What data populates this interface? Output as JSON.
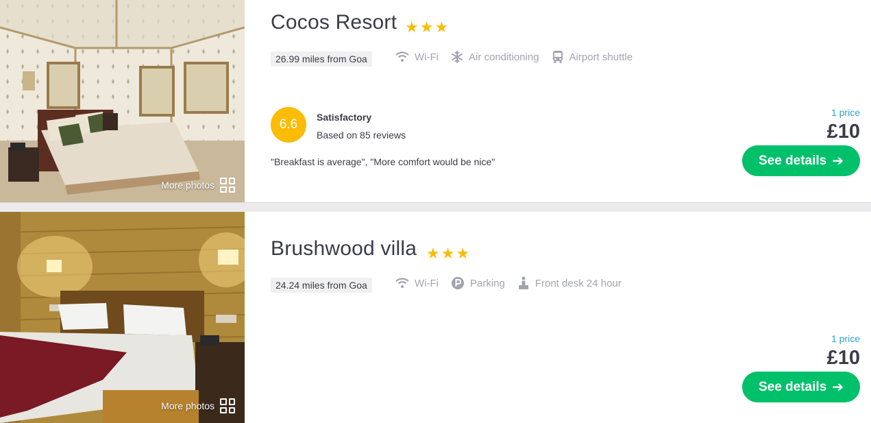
{
  "hotels": [
    {
      "name": "Cocos Resort",
      "star_rating": 3,
      "distance": "26.99 miles from Goa",
      "amenities": [
        {
          "icon": "wifi-icon",
          "label": "Wi-Fi"
        },
        {
          "icon": "snowflake-icon",
          "label": "Air conditioning"
        },
        {
          "icon": "bus-icon",
          "label": "Airport shuttle"
        }
      ],
      "score": "6.6",
      "rating_word": "Satisfactory",
      "review_count": "Based on 85 reviews",
      "quote": "\"Breakfast is average\", \"More comfort would be nice\"",
      "price_count": "1 price",
      "price": "£10",
      "cta": "See details",
      "more_photos": "More photos"
    },
    {
      "name": "Brushwood villa",
      "star_rating": 3,
      "distance": "24.24 miles from Goa",
      "amenities": [
        {
          "icon": "wifi-icon",
          "label": "Wi-Fi"
        },
        {
          "icon": "parking-icon",
          "label": "Parking"
        },
        {
          "icon": "front-desk-icon",
          "label": "Front desk 24 hour"
        }
      ],
      "price_count": "1 price",
      "price": "£10",
      "cta": "See details",
      "more_photos": "More photos"
    }
  ],
  "colors": {
    "star": "#fbbc05",
    "score_badge": "#fbbc05",
    "cta": "#00c16a",
    "price_count": "#2ba3d1",
    "amenity_text": "#a3a3b0"
  }
}
